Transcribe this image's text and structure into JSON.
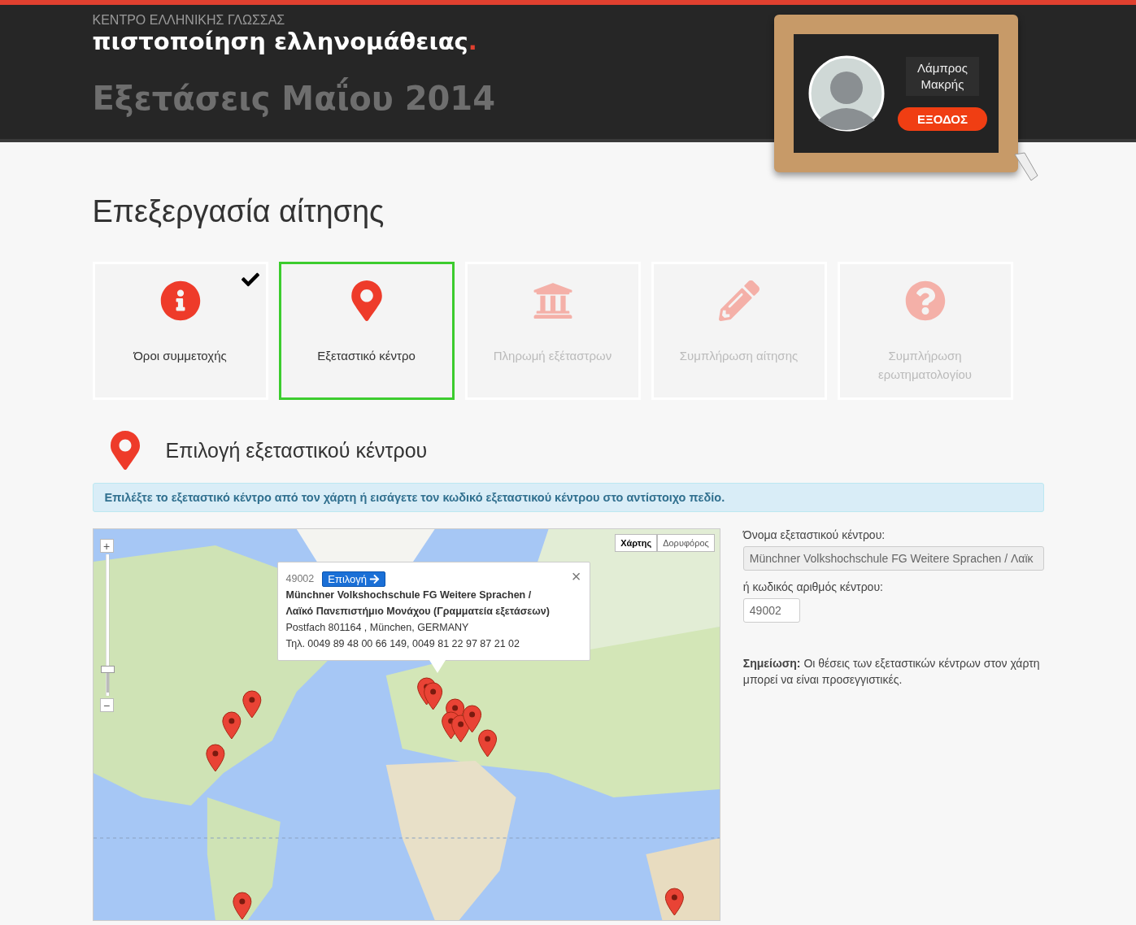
{
  "header": {
    "org": "ΚΕΝΤΡΟ ΕΛΛΗΝΙΚΗΣ ΓΛΩΣΣΑΣ",
    "title": "πιστοποίηση ελληνομάθειας",
    "title_dot": ".",
    "exam": "Εξετάσεις Μαΐου 2014"
  },
  "user": {
    "name_line1": "Λάμπρος",
    "name_line2": "Μακρής",
    "logout": "ΕΞΟΔΟΣ"
  },
  "page_title": "Επεξεργασία αίτησης",
  "steps": [
    {
      "kind": "info",
      "label": "Όροι συμμετοχής",
      "done": true,
      "selected": false,
      "disabled": false
    },
    {
      "kind": "pin",
      "label": "Εξεταστικό κέντρο",
      "done": false,
      "selected": true,
      "disabled": false
    },
    {
      "kind": "bank",
      "label": "Πληρωμή εξέταστρων",
      "done": false,
      "selected": false,
      "disabled": true
    },
    {
      "kind": "pencil",
      "label": "Συμπλήρωση αίτησης",
      "done": false,
      "selected": false,
      "disabled": true
    },
    {
      "kind": "question",
      "label": "Συμπλήρωση ερωτηματολογίου",
      "done": false,
      "selected": false,
      "disabled": true
    }
  ],
  "section_title": "Επιλογή εξεταστικού κέντρου",
  "info": "Επιλέξτε το εξεταστικό κέντρο από τον χάρτη ή εισάγετε τον κωδικό εξεταστικού κέντρου στο αντίστοιχο πεδίο.",
  "map": {
    "kind": "picture",
    "zoom_in": "+",
    "zoom_out": "−",
    "zoom": {
      "level": 0.17
    },
    "map_types": [
      {
        "label": "Χάρτης",
        "selected": true
      },
      {
        "label": "Δορυφόρος",
        "selected": false
      }
    ],
    "popup": {
      "code": "49002",
      "select": "Επιλογή",
      "close": "×",
      "name_line1": "Münchner Volkshochschule FG Weitere Sprachen /",
      "name_line2": "Λαϊκό Πανεπιστήμιο Μονάχου (Γραμματεία εξετάσεων)",
      "address": "Postfach 801164 , München, GERMANY",
      "phone": "Τηλ. 0049 89 48 00 66 149, 0049 81 22 97 87 21 02"
    }
  },
  "form": {
    "name_label": "Όνομα εξεταστικού κέντρου:",
    "name_value": "Münchner Volkshochschule FG Weitere Sprachen  /  Λαϊκ",
    "code_label": "ή κωδικός αριθμός κέντρου:",
    "code_value": "49002",
    "note": "**Σημείωση:** Οι θέσεις των εξεταστικών κέντρων στον χάρτη μπορεί να είναι προσεγγιστικές."
  }
}
